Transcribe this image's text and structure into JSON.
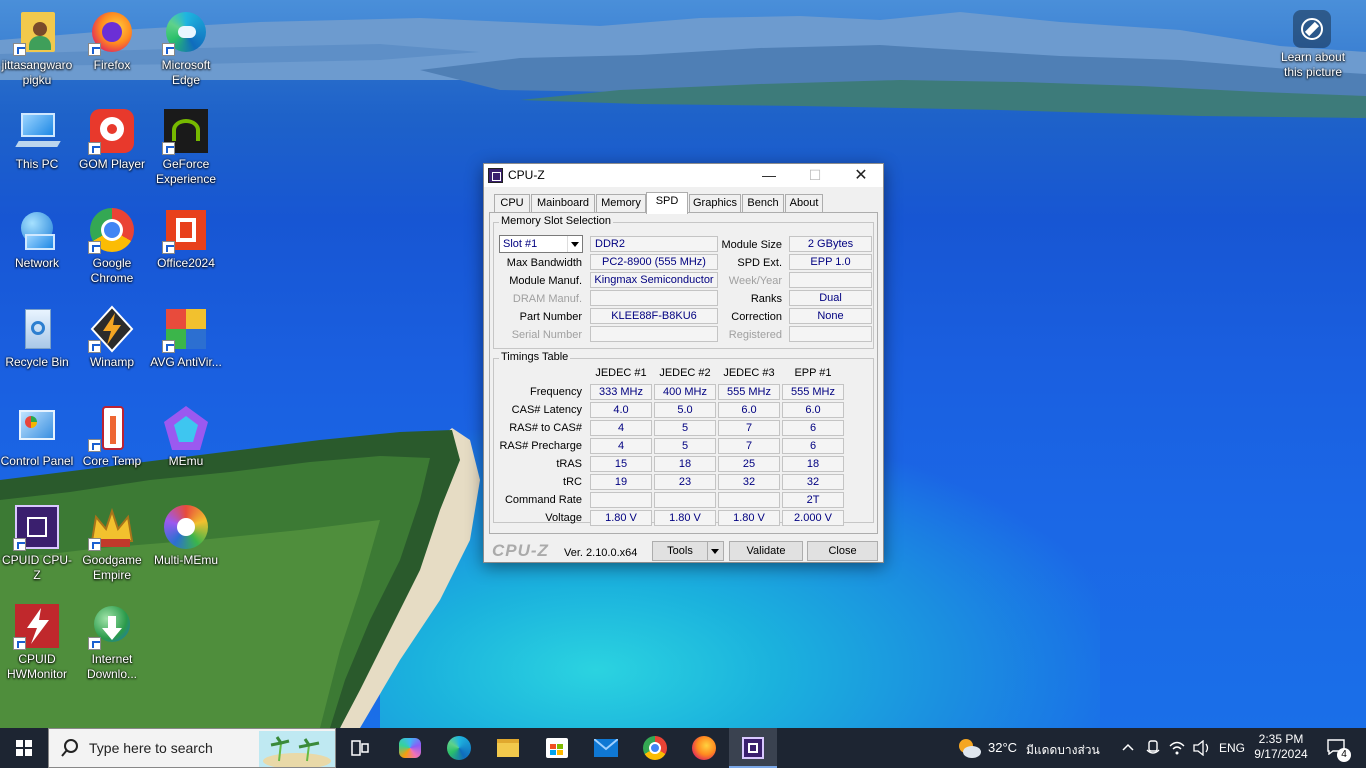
{
  "desktop": {
    "icons": [
      {
        "name": "jittasangwaropigku",
        "label": "jittasangwaro pigku",
        "icon": "user-folder-icon"
      },
      {
        "name": "firefox",
        "label": "Firefox",
        "icon": "firefox-icon"
      },
      {
        "name": "microsoft-edge",
        "label": "Microsoft Edge",
        "icon": "edge-icon"
      },
      {
        "name": "this-pc",
        "label": "This PC",
        "icon": "computer-icon"
      },
      {
        "name": "gom-player",
        "label": "GOM Player",
        "icon": "gom-player-icon"
      },
      {
        "name": "geforce-experience",
        "label": "GeForce Experience",
        "icon": "nvidia-icon"
      },
      {
        "name": "network",
        "label": "Network",
        "icon": "network-icon"
      },
      {
        "name": "google-chrome",
        "label": "Google Chrome",
        "icon": "chrome-icon"
      },
      {
        "name": "office2024",
        "label": "Office2024",
        "icon": "office-icon"
      },
      {
        "name": "recycle-bin",
        "label": "Recycle Bin",
        "icon": "recycle-bin-icon"
      },
      {
        "name": "winamp",
        "label": "Winamp",
        "icon": "winamp-icon"
      },
      {
        "name": "avg-antivirus",
        "label": "AVG AntiVir...",
        "icon": "avg-icon"
      },
      {
        "name": "control-panel",
        "label": "Control Panel",
        "icon": "control-panel-icon"
      },
      {
        "name": "core-temp",
        "label": "Core Temp",
        "icon": "thermometer-icon"
      },
      {
        "name": "memu",
        "label": "MEmu",
        "icon": "memu-icon"
      },
      {
        "name": "cpuid-cpuz",
        "label": "CPUID CPU-Z",
        "icon": "cpuz-icon"
      },
      {
        "name": "goodgame-empire",
        "label": "Goodgame Empire",
        "icon": "crown-icon"
      },
      {
        "name": "multi-memu",
        "label": "Multi-MEmu",
        "icon": "multi-memu-icon"
      },
      {
        "name": "cpuid-hwmonitor",
        "label": "CPUID HWMonitor",
        "icon": "hwmonitor-icon"
      },
      {
        "name": "internet-download",
        "label": "Internet Downlo...",
        "icon": "idm-icon"
      }
    ],
    "learn_about": "Learn about this picture"
  },
  "cpuz": {
    "title": "CPU-Z",
    "tabs": [
      "CPU",
      "Mainboard",
      "Memory",
      "SPD",
      "Graphics",
      "Bench",
      "About"
    ],
    "active_tab": "SPD",
    "slot_group_title": "Memory Slot Selection",
    "slot_selected": "Slot #1",
    "memory_type": "DDR2",
    "module_size_label": "Module Size",
    "module_size": "2 GBytes",
    "max_bandwidth_label": "Max Bandwidth",
    "max_bandwidth": "PC2-8900 (555 MHz)",
    "spd_ext_label": "SPD Ext.",
    "spd_ext": "EPP 1.0",
    "module_manuf_label": "Module Manuf.",
    "module_manuf": "Kingmax Semiconductor",
    "week_year_label": "Week/Year",
    "dram_manuf_label": "DRAM Manuf.",
    "ranks_label": "Ranks",
    "ranks": "Dual",
    "part_number_label": "Part Number",
    "part_number": "KLEE88F-B8KU6",
    "correction_label": "Correction",
    "correction": "None",
    "serial_number_label": "Serial Number",
    "registered_label": "Registered",
    "timings_title": "Timings Table",
    "timing_columns": [
      "JEDEC #1",
      "JEDEC #2",
      "JEDEC #3",
      "EPP #1"
    ],
    "timing_rows": [
      {
        "label": "Frequency",
        "values": [
          "333 MHz",
          "400 MHz",
          "555 MHz",
          "555 MHz"
        ]
      },
      {
        "label": "CAS# Latency",
        "values": [
          "4.0",
          "5.0",
          "6.0",
          "6.0"
        ]
      },
      {
        "label": "RAS# to CAS#",
        "values": [
          "4",
          "5",
          "7",
          "6"
        ]
      },
      {
        "label": "RAS# Precharge",
        "values": [
          "4",
          "5",
          "7",
          "6"
        ]
      },
      {
        "label": "tRAS",
        "values": [
          "15",
          "18",
          "25",
          "18"
        ]
      },
      {
        "label": "tRC",
        "values": [
          "19",
          "23",
          "32",
          "32"
        ]
      },
      {
        "label": "Command Rate",
        "values": [
          "",
          "",
          "",
          "2T"
        ]
      },
      {
        "label": "Voltage",
        "values": [
          "1.80 V",
          "1.80 V",
          "1.80 V",
          "2.000 V"
        ]
      }
    ],
    "logo": "CPU-Z",
    "version": "Ver. 2.10.0.x64",
    "tools_label": "Tools",
    "validate_label": "Validate",
    "close_label": "Close"
  },
  "taskbar": {
    "search_placeholder": "Type here to search",
    "weather_temp": "32°C",
    "weather_text": "มีแดดบางส่วน",
    "language": "ENG",
    "time": "2:35 PM",
    "date": "9/17/2024",
    "notification_count": "4"
  }
}
